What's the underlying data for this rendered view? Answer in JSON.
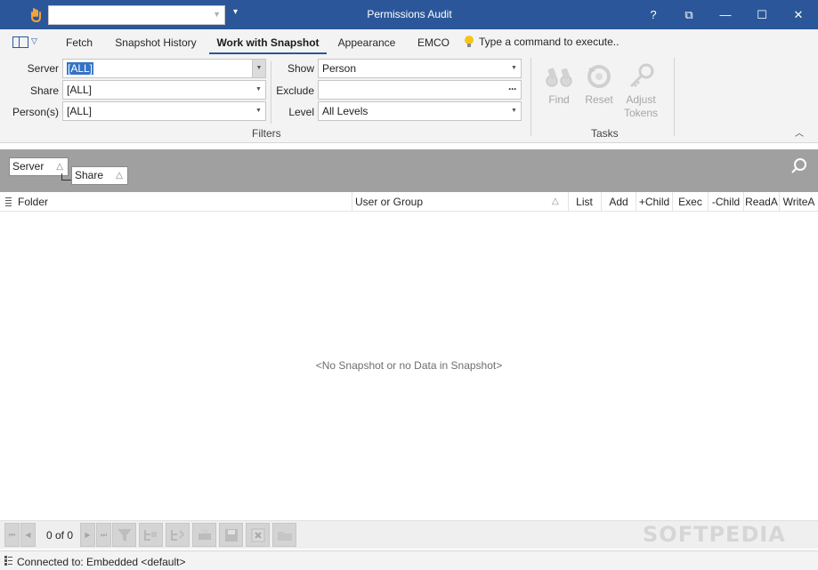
{
  "window": {
    "title": "Permissions Audit",
    "buttons": {
      "help": "?",
      "restore": "⧉",
      "minimize": "—",
      "maximize": "☐",
      "close": "✕"
    }
  },
  "quick_access": {
    "combo_value": "",
    "more": "▾"
  },
  "ribbon": {
    "tabs": [
      "Fetch",
      "Snapshot History",
      "Work with Snapshot",
      "Appearance",
      "EMCO"
    ],
    "active_tab": "Work with Snapshot",
    "command_placeholder": "Type a command to execute..",
    "filters": {
      "server_label": "Server",
      "server_value": "[ALL]",
      "share_label": "Share",
      "share_value": "[ALL]",
      "persons_label": "Person(s)",
      "persons_value": "[ALL]",
      "show_label": "Show",
      "show_value": "Person",
      "exclude_label": "Exclude",
      "exclude_value": "",
      "level_label": "Level",
      "level_value": "All Levels",
      "group_title": "Filters"
    },
    "tasks": {
      "find": "Find",
      "reset": "Reset",
      "adjust_tokens_1": "Adjust",
      "adjust_tokens_2": "Tokens",
      "group_title": "Tasks"
    }
  },
  "group_by": {
    "chips": [
      "Server",
      "Share"
    ]
  },
  "grid": {
    "columns": [
      "Folder",
      "User or Group",
      "List",
      "Add",
      "+Child",
      "Exec",
      "-Child",
      "ReadA",
      "WriteA"
    ],
    "empty_message": "<No Snapshot or no Data in Snapshot>"
  },
  "navigator": {
    "page_info": "0 of 0"
  },
  "status": {
    "text": "Connected to: Embedded <default>"
  },
  "watermark": "SOFTPEDIA",
  "colors": {
    "accent": "#2b579a",
    "selection": "#3373c4",
    "groupby_bg": "#a0a0a0"
  }
}
